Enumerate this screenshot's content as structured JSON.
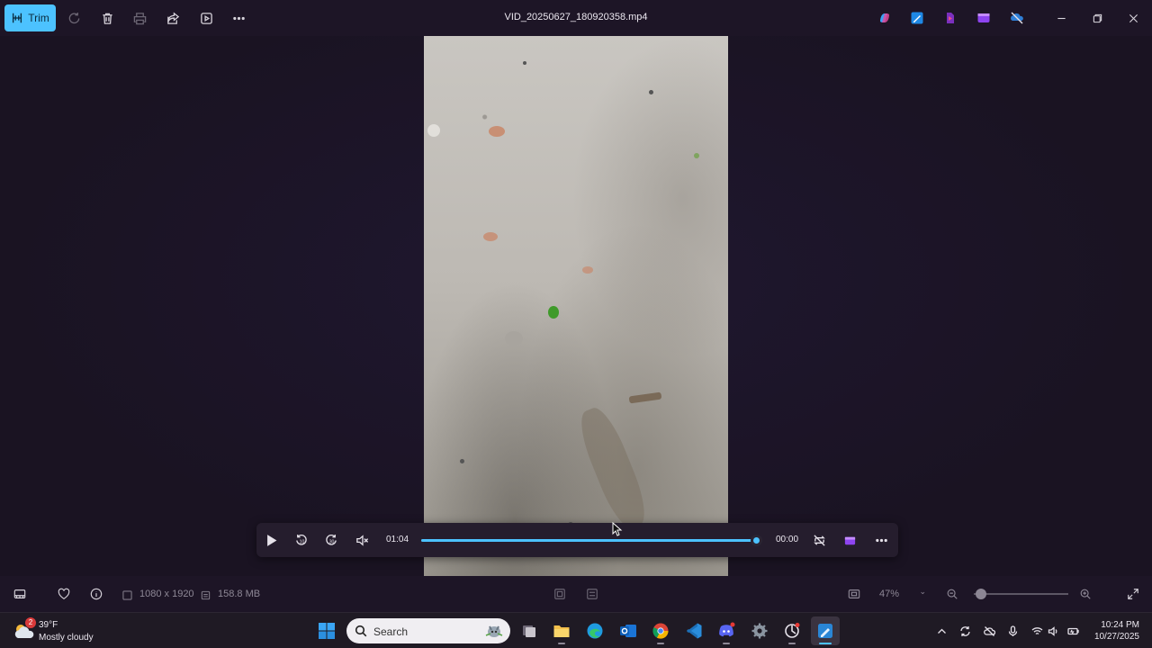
{
  "titlebar": {
    "trim_label": "Trim",
    "file_name": "VID_20250627_180920358.mp4"
  },
  "player": {
    "elapsed": "01:04",
    "remaining": "00:00",
    "progress_fraction": 1.0,
    "rewind_label": "10",
    "forward_label": "30"
  },
  "infobar": {
    "dimensions": "1080 x 1920",
    "file_size": "158.8 MB",
    "zoom_level": "47%"
  },
  "taskbar": {
    "weather_temp": "39°F",
    "weather_condition": "Mostly cloudy",
    "weather_badge": "2",
    "search_placeholder": "Search",
    "time": "10:24 PM",
    "date": "10/27/2025"
  },
  "colors": {
    "accent": "#4cc2ff",
    "background": "#1c1424"
  }
}
